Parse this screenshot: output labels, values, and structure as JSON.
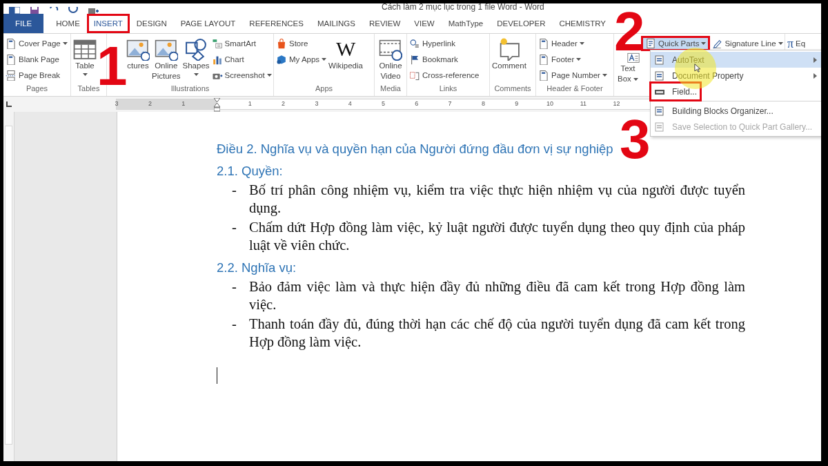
{
  "title_bar": {
    "title": "Cách làm 2 mục lục trong 1 file Word - Word"
  },
  "tabs": [
    {
      "label": "FILE",
      "kind": "file",
      "selected": false,
      "highlighted": false
    },
    {
      "label": "HOME",
      "kind": "tab",
      "selected": false,
      "highlighted": false
    },
    {
      "label": "INSERT",
      "kind": "tab",
      "selected": true,
      "highlighted": true
    },
    {
      "label": "DESIGN",
      "kind": "tab",
      "selected": false,
      "highlighted": false
    },
    {
      "label": "PAGE LAYOUT",
      "kind": "tab",
      "selected": false,
      "highlighted": false
    },
    {
      "label": "REFERENCES",
      "kind": "tab",
      "selected": false,
      "highlighted": false
    },
    {
      "label": "MAILINGS",
      "kind": "tab",
      "selected": false,
      "highlighted": false
    },
    {
      "label": "REVIEW",
      "kind": "tab",
      "selected": false,
      "highlighted": false
    },
    {
      "label": "VIEW",
      "kind": "tab",
      "selected": false,
      "highlighted": false
    },
    {
      "label": "MathType",
      "kind": "tab",
      "selected": false,
      "highlighted": false
    },
    {
      "label": "DEVELOPER",
      "kind": "tab",
      "selected": false,
      "highlighted": false
    },
    {
      "label": "CHEMISTRY",
      "kind": "tab",
      "selected": false,
      "highlighted": false
    }
  ],
  "ribbon_groups": [
    {
      "label": "Pages",
      "items": [
        {
          "kind": "stack",
          "items": [
            {
              "label": "Cover Page",
              "dropdown": true
            },
            {
              "label": "Blank Page",
              "dropdown": false
            },
            {
              "label": "Page Break",
              "dropdown": false
            }
          ]
        }
      ]
    },
    {
      "label": "Tables",
      "items": [
        {
          "kind": "large",
          "label": "Table",
          "dropdown": true
        }
      ]
    },
    {
      "label": "Illustrations",
      "items": [
        {
          "kind": "large",
          "label": "ctures",
          "dropdown": false
        },
        {
          "kind": "large",
          "label": "Online Pictures",
          "dropdown": false
        },
        {
          "kind": "large",
          "label": "Shapes",
          "dropdown": true
        },
        {
          "kind": "stack",
          "items": [
            {
              "label": "SmartArt",
              "dropdown": false
            },
            {
              "label": "Chart",
              "dropdown": false
            },
            {
              "label": "Screenshot",
              "dropdown": true
            }
          ]
        }
      ]
    },
    {
      "label": "Apps",
      "items": [
        {
          "kind": "stack",
          "items": [
            {
              "label": "Store",
              "dropdown": false
            },
            {
              "label": "My Apps",
              "dropdown": true
            }
          ]
        },
        {
          "kind": "large",
          "label": "Wikipedia",
          "icon_text": "W",
          "dropdown": false
        }
      ]
    },
    {
      "label": "Media",
      "items": [
        {
          "kind": "large",
          "label": "Online Video",
          "dropdown": false
        }
      ]
    },
    {
      "label": "Links",
      "items": [
        {
          "kind": "stack",
          "items": [
            {
              "label": "Hyperlink",
              "dropdown": false
            },
            {
              "label": "Bookmark",
              "dropdown": false
            },
            {
              "label": "Cross-reference",
              "dropdown": false
            }
          ]
        }
      ]
    },
    {
      "label": "Comments",
      "items": [
        {
          "kind": "large",
          "label": "Comment",
          "dropdown": false
        }
      ]
    },
    {
      "label": "Header & Footer",
      "items": [
        {
          "kind": "stack",
          "items": [
            {
              "label": "Header",
              "dropdown": true
            },
            {
              "label": "Footer",
              "dropdown": true
            },
            {
              "label": "Page Number",
              "dropdown": true
            }
          ]
        }
      ]
    },
    {
      "items": [
        {
          "kind": "large",
          "label": "Text Box",
          "dropdown": true
        },
        {
          "kind": "stack",
          "items": [
            {
              "label": "Quick Parts",
              "dropdown": true,
              "selected": true,
              "highlighted": true
            }
          ]
        },
        {
          "kind": "stack",
          "items": [
            {
              "label": "Signature Line",
              "dropdown": true,
              "selected": false,
              "highlighted": false
            }
          ]
        }
      ]
    },
    {
      "items": [
        {
          "kind": "stack",
          "items": [
            {
              "label": "Eq",
              "icon_text": "π",
              "dropdown": false
            }
          ]
        }
      ]
    }
  ],
  "ruler": {
    "left_marks": [
      "3",
      "2",
      "1"
    ],
    "right_marks": [
      "1",
      "2",
      "3",
      "4",
      "5",
      "6",
      "7",
      "8",
      "9",
      "10",
      "11",
      "12"
    ]
  },
  "quick_parts_menu": {
    "items": [
      {
        "kind": "submenu",
        "label": "AutoText",
        "selected": true,
        "highlighted": false,
        "disabled": false
      },
      {
        "kind": "submenu",
        "label": "Document Property",
        "selected": false,
        "highlighted": false,
        "disabled": false
      },
      {
        "kind": "item",
        "label": "Field...",
        "selected": false,
        "highlighted": true,
        "disabled": false
      },
      {
        "kind": "separator"
      },
      {
        "kind": "item",
        "label": "Building Blocks Organizer...",
        "selected": false,
        "highlighted": false,
        "disabled": false
      },
      {
        "kind": "item",
        "label": "Save Selection to Quick Part Gallery...",
        "selected": false,
        "highlighted": false,
        "disabled": true
      }
    ]
  },
  "document": {
    "paragraphs": [
      {
        "kind": "heading",
        "text": "Điều 2. Nghĩa vụ và quyền hạn của Người đứng đầu đơn vị sự nghiệp"
      },
      {
        "kind": "subheading",
        "text": "2.1. Quyền:"
      },
      {
        "kind": "bullet",
        "marker": "-",
        "text": "Bố trí phân công nhiệm vụ, kiểm tra việc thực hiện nhiệm vụ của người được tuyển dụng."
      },
      {
        "kind": "bullet",
        "marker": "-",
        "text": "Chấm dứt Hợp đồng làm việc, kỷ luật người được tuyển dụng theo quy định của pháp luật về viên chức."
      },
      {
        "kind": "subheading",
        "text": "2.2. Nghĩa vụ:"
      },
      {
        "kind": "bullet",
        "marker": "-",
        "text": "Bảo đảm việc làm và thực hiện đầy đủ những điều đã cam kết trong Hợp đồng làm việc."
      },
      {
        "kind": "bullet",
        "marker": "-",
        "text": "Thanh toán đầy đủ, đúng thời hạn các chế độ của người tuyển dụng đã cam kết trong Hợp đồng làm việc."
      }
    ]
  },
  "annotations": [
    {
      "label": "1"
    },
    {
      "label": "2"
    },
    {
      "label": "3"
    }
  ]
}
